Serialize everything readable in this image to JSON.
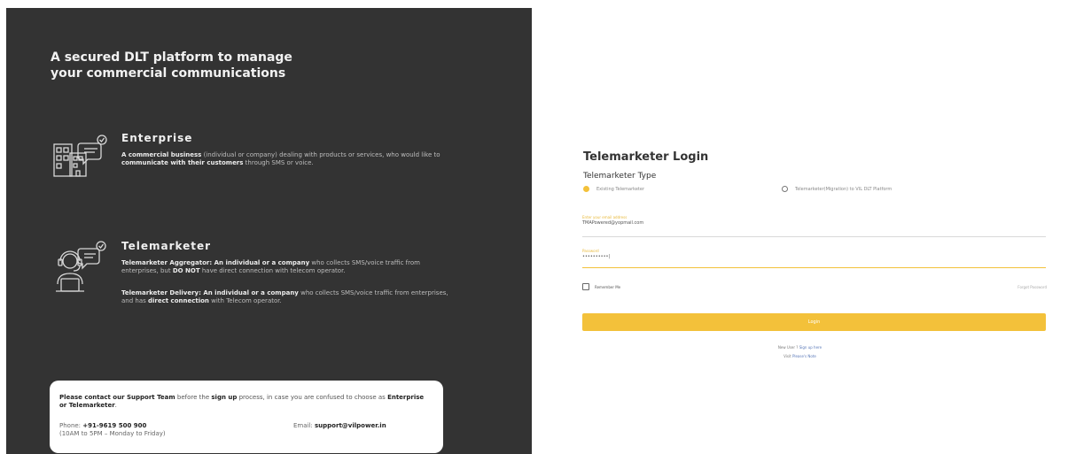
{
  "left": {
    "hero": "A secured DLT platform to manage your commercial communications",
    "enterprise": {
      "title": "Enterprise",
      "desc_p1": "A commercial business",
      "desc_p2": " (individual or company) dealing with products or services, who would like to ",
      "desc_p3": "communicate with their customers",
      "desc_p4": " through SMS or voice."
    },
    "telemarketer": {
      "title": "Telemarketer",
      "agg_p1": "Telemarketer Aggregator: An individual or a company",
      "agg_p2": " who collects SMS/voice traffic from enterprises, but ",
      "agg_p3": "DO NOT",
      "agg_p4": " have direct connection with telecom operator.",
      "del_p1": "Telemarketer Delivery: An individual or a company",
      "del_p2": " who collects SMS/voice traffic from enterprises, and has ",
      "del_p3": "direct connection",
      "del_p4": " with Telecom operator."
    },
    "support": {
      "msg_p1": "Please contact our Support Team",
      "msg_p2": " before the ",
      "msg_p3": "sign up",
      "msg_p4": " process, in case you are confused to choose as ",
      "msg_p5": "Enterprise or Telemarketer",
      "msg_p6": ".",
      "phone_label": "Phone: ",
      "phone": "+91-9619 500 900",
      "hours": "(10AM to 5PM – Monday to Friday)",
      "email_label": "Email: ",
      "email": "support@vilpower.in"
    }
  },
  "login": {
    "title": "Telemarketer Login",
    "type_label": "Telemarketer Type",
    "radio_existing": "Existing Telemarketer",
    "radio_new": "Telemarketer(Migration) to VIL DLT Platform",
    "email_label": "Enter your email address",
    "email_value": "TMAPowered@yopmail.com",
    "password_label": "Password",
    "password_value": "••••••••••|",
    "remember": "Remember Me",
    "forgot": "Forgot Password",
    "submit": "Login",
    "new_user_text": "New User ?",
    "new_user_link": " Sign up here",
    "visit_text": "Visit",
    "visit_link": " Please's Note"
  },
  "colors": {
    "panel": "#333333",
    "accent": "#f3c13a"
  },
  "icons": [
    "building-chat-icon",
    "headset-agent-chat-icon",
    "radio-icon",
    "checkbox-icon"
  ]
}
